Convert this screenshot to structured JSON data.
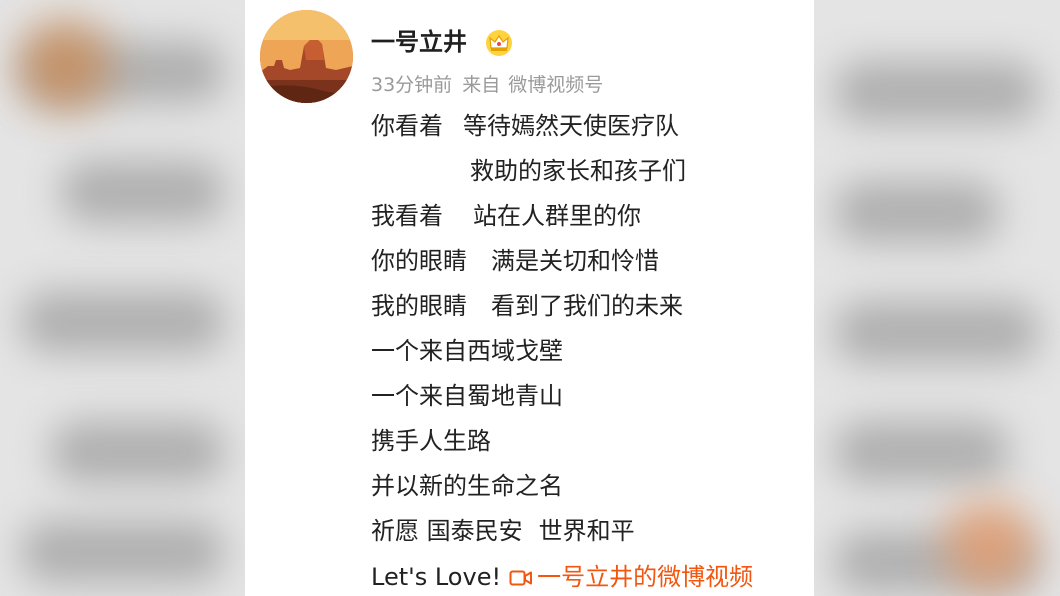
{
  "post": {
    "username": "一号立井",
    "crown_icon": "crown-icon",
    "time": "33分钟前",
    "source_prefix": "来自",
    "source": "微博视频号",
    "lines": [
      {
        "a": "你看着",
        "b": "等待嫣然天使医疗队"
      },
      {
        "a": "",
        "b": "救助的家长和孩子们"
      },
      {
        "a": "我看着",
        "b": "站在人群里的你"
      },
      {
        "a": "你的眼睛",
        "b": "满是关切和怜惜"
      },
      {
        "a": "我的眼睛",
        "b": "看到了我们的未来"
      },
      {
        "a": "一个来自西域戈壁",
        "b": ""
      },
      {
        "a": "一个来自蜀地青山",
        "b": ""
      },
      {
        "a": "携手人生路",
        "b": ""
      },
      {
        "a": "并以新的生命之名",
        "b": ""
      },
      {
        "a": "祈愿 国泰民安",
        "b": "世界和平"
      }
    ],
    "last_text": "Let's Love!",
    "video_link": "一号立井的微博视频",
    "video_icon": "video-camera-icon",
    "link_color": "#f2560f"
  }
}
